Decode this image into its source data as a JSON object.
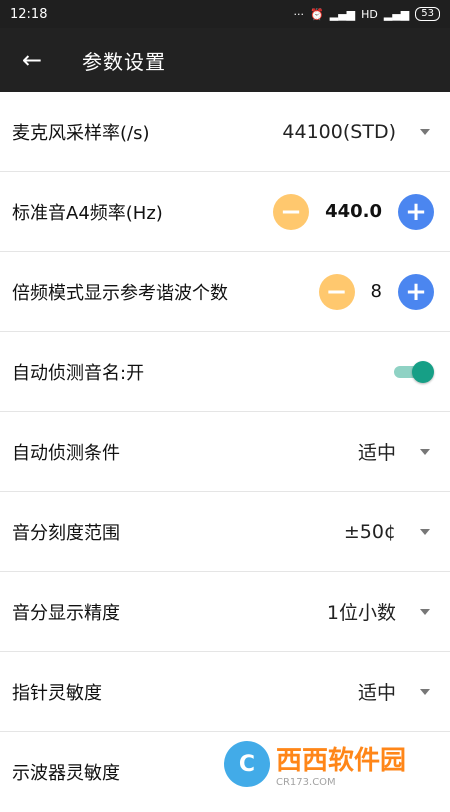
{
  "status": {
    "time": "12:18",
    "icons": [
      "dots-icon",
      "alarm-icon",
      "signal-icon",
      "hd-icon",
      "signal-icon"
    ],
    "battery": "53"
  },
  "app_bar": {
    "back_icon": "arrow-left-icon",
    "title": "参数设置"
  },
  "settings": [
    {
      "label": "麦克风采样率(/s)",
      "value": "44100(STD)"
    },
    {
      "label": "标准音A4频率(Hz)",
      "value": "440.0"
    },
    {
      "label": "倍频模式显示参考谐波个数",
      "value": "8"
    },
    {
      "label": "自动侦测音名:开",
      "toggle": true
    },
    {
      "label": "自动侦测条件",
      "value": "适中"
    },
    {
      "label": "音分刻度范围",
      "value": "±50¢"
    },
    {
      "label": "音分显示精度",
      "value": "1位小数"
    },
    {
      "label": "指针灵敏度",
      "value": "适中"
    },
    {
      "label": "示波器灵敏度",
      "value": ""
    }
  ],
  "watermark": {
    "brand_text": "西西软件园",
    "sub": "CR173.COM"
  },
  "colors": {
    "minus": "#ffc86e",
    "plus": "#4b86f0",
    "toggle": "#169f86"
  }
}
